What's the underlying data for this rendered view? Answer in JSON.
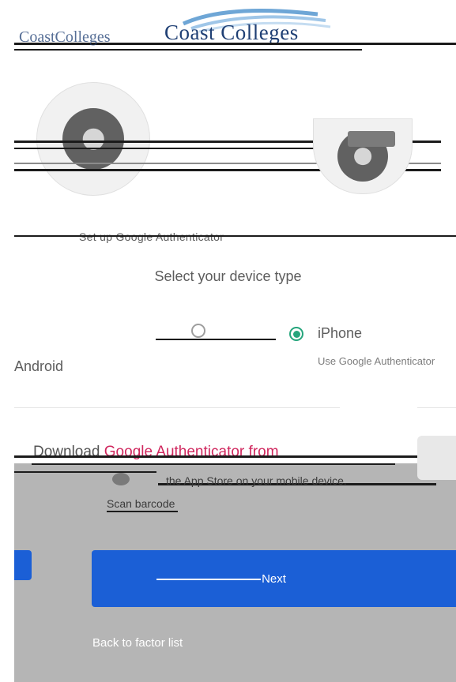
{
  "header": {
    "logo_text": "Coast Colleges",
    "ghost_logo_text": "CoastColleges"
  },
  "setup": {
    "instruction_scribble": "Set up Google Authenticator",
    "device_prompt": "Select your device type",
    "options": [
      {
        "label": "iPhone",
        "checked": true
      },
      {
        "label": "Android",
        "checked": false
      }
    ],
    "small_note": "Use Google Authenticator",
    "download_prefix": "Download ",
    "download_link": "Google Authenticator from",
    "download_caption": "the App Store on your mobile device.",
    "scan_caption": "Scan barcode"
  },
  "actions": {
    "next_label": "Next",
    "back_label": "Back to factor list"
  },
  "colors": {
    "accent_green": "#25a57c",
    "link_pink": "#d0275e",
    "button_blue": "#1b5fd6"
  }
}
